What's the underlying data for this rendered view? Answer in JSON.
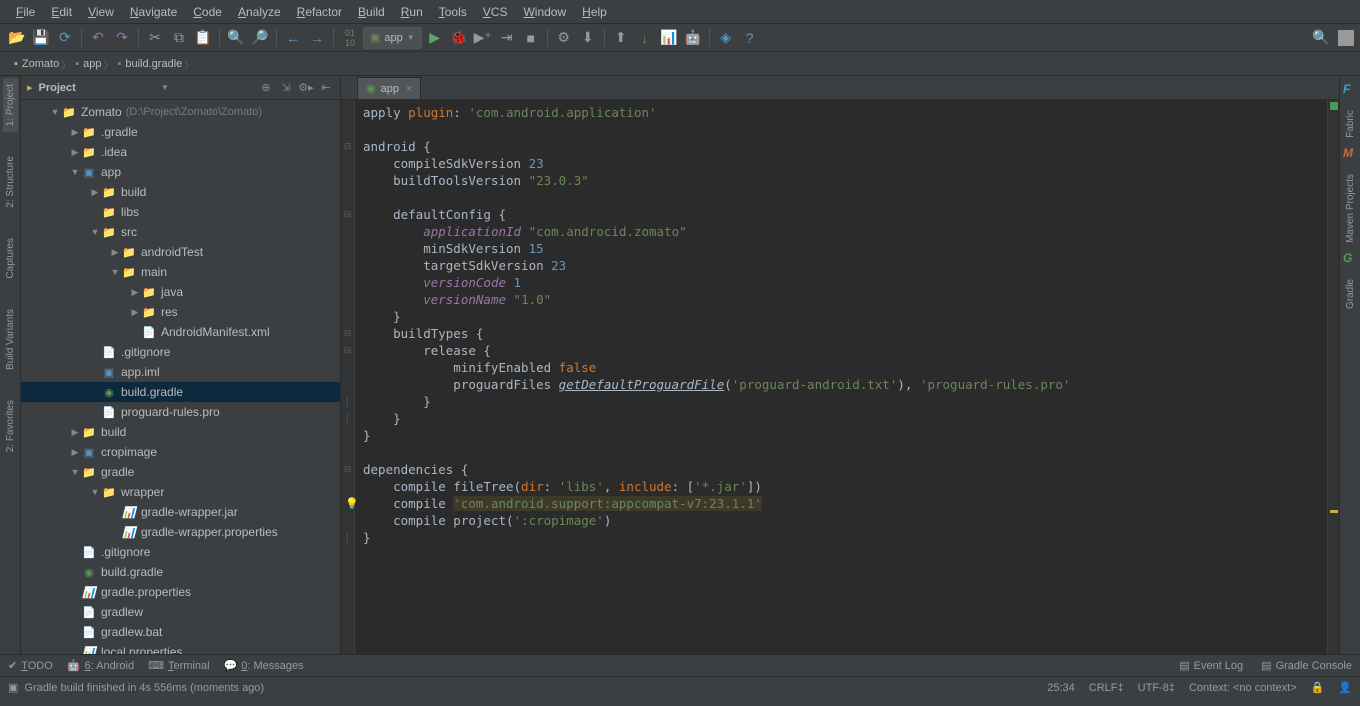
{
  "menu": [
    "File",
    "Edit",
    "View",
    "Navigate",
    "Code",
    "Analyze",
    "Refactor",
    "Build",
    "Run",
    "Tools",
    "VCS",
    "Window",
    "Help"
  ],
  "module_selector": "app",
  "breadcrumbs": [
    {
      "icon": "folder",
      "label": "Zomato"
    },
    {
      "icon": "module",
      "label": "app"
    },
    {
      "icon": "gradle",
      "label": "build.gradle"
    }
  ],
  "left_tabs": [
    "1: Project",
    "2: Structure",
    "Captures",
    "Build Variants",
    "2: Favorites"
  ],
  "right_tabs": [
    "Fabric",
    "Maven Projects",
    "Gradle"
  ],
  "project_tool": {
    "title": "Project"
  },
  "tree": [
    {
      "d": 0,
      "a": "v",
      "i": "folder",
      "n": "Zomato",
      "suffix": "(D:\\Project\\Zomato\\Zomato)"
    },
    {
      "d": 1,
      "a": ">",
      "i": "folder",
      "n": ".gradle"
    },
    {
      "d": 1,
      "a": ">",
      "i": "folder",
      "n": ".idea"
    },
    {
      "d": 1,
      "a": "v",
      "i": "module",
      "n": "app"
    },
    {
      "d": 2,
      "a": ">",
      "i": "folder",
      "n": "build"
    },
    {
      "d": 2,
      "a": "",
      "i": "folder",
      "n": "libs"
    },
    {
      "d": 2,
      "a": "v",
      "i": "folderb",
      "n": "src"
    },
    {
      "d": 3,
      "a": ">",
      "i": "folder",
      "n": "androidTest"
    },
    {
      "d": 3,
      "a": "v",
      "i": "folder",
      "n": "main"
    },
    {
      "d": 4,
      "a": ">",
      "i": "folderb",
      "n": "java"
    },
    {
      "d": 4,
      "a": ">",
      "i": "folder",
      "n": "res"
    },
    {
      "d": 4,
      "a": "",
      "i": "xml",
      "n": "AndroidManifest.xml"
    },
    {
      "d": 2,
      "a": "",
      "i": "file",
      "n": ".gitignore"
    },
    {
      "d": 2,
      "a": "",
      "i": "module",
      "n": "app.iml"
    },
    {
      "d": 2,
      "a": "",
      "i": "gradle",
      "n": "build.gradle",
      "sel": true
    },
    {
      "d": 2,
      "a": "",
      "i": "file",
      "n": "proguard-rules.pro"
    },
    {
      "d": 1,
      "a": ">",
      "i": "folder",
      "n": "build"
    },
    {
      "d": 1,
      "a": ">",
      "i": "module",
      "n": "cropimage"
    },
    {
      "d": 1,
      "a": "v",
      "i": "folder",
      "n": "gradle"
    },
    {
      "d": 2,
      "a": "v",
      "i": "folder",
      "n": "wrapper"
    },
    {
      "d": 3,
      "a": "",
      "i": "prop",
      "n": "gradle-wrapper.jar"
    },
    {
      "d": 3,
      "a": "",
      "i": "prop",
      "n": "gradle-wrapper.properties"
    },
    {
      "d": 1,
      "a": "",
      "i": "file",
      "n": ".gitignore"
    },
    {
      "d": 1,
      "a": "",
      "i": "gradle",
      "n": "build.gradle"
    },
    {
      "d": 1,
      "a": "",
      "i": "prop",
      "n": "gradle.properties"
    },
    {
      "d": 1,
      "a": "",
      "i": "file",
      "n": "gradlew"
    },
    {
      "d": 1,
      "a": "",
      "i": "file",
      "n": "gradlew.bat"
    },
    {
      "d": 1,
      "a": "",
      "i": "prop",
      "n": "local.properties"
    }
  ],
  "editor_tab": {
    "label": "app"
  },
  "code_lines": [
    [
      {
        "t": "apply ",
        "c": "id"
      },
      {
        "t": "plugin",
        "c": "kw"
      },
      {
        "t": ": ",
        "c": "id"
      },
      {
        "t": "'com.android.application'",
        "c": "str"
      }
    ],
    [],
    [
      {
        "t": "android {",
        "c": "id"
      }
    ],
    [
      {
        "t": "    compileSdkVersion ",
        "c": "id"
      },
      {
        "t": "23",
        "c": "num"
      }
    ],
    [
      {
        "t": "    buildToolsVersion ",
        "c": "id"
      },
      {
        "t": "\"23.0.3\"",
        "c": "str"
      }
    ],
    [],
    [
      {
        "t": "    defaultConfig {",
        "c": "id"
      }
    ],
    [
      {
        "t": "        ",
        "c": "id"
      },
      {
        "t": "applicationId",
        "c": "prop"
      },
      {
        "t": " ",
        "c": "id"
      },
      {
        "t": "\"com.androcid.zomato\"",
        "c": "str"
      }
    ],
    [
      {
        "t": "        minSdkVersion ",
        "c": "id"
      },
      {
        "t": "15",
        "c": "num"
      }
    ],
    [
      {
        "t": "        targetSdkVersion ",
        "c": "id"
      },
      {
        "t": "23",
        "c": "num"
      }
    ],
    [
      {
        "t": "        ",
        "c": "id"
      },
      {
        "t": "versionCode",
        "c": "prop"
      },
      {
        "t": " ",
        "c": "id"
      },
      {
        "t": "1",
        "c": "num"
      }
    ],
    [
      {
        "t": "        ",
        "c": "id"
      },
      {
        "t": "versionName",
        "c": "prop"
      },
      {
        "t": " ",
        "c": "id"
      },
      {
        "t": "\"1.0\"",
        "c": "str"
      }
    ],
    [
      {
        "t": "    }",
        "c": "id"
      }
    ],
    [
      {
        "t": "    buildTypes {",
        "c": "id"
      }
    ],
    [
      {
        "t": "        release {",
        "c": "id"
      }
    ],
    [
      {
        "t": "            minifyEnabled ",
        "c": "id"
      },
      {
        "t": "false",
        "c": "kw"
      }
    ],
    [
      {
        "t": "            proguardFiles ",
        "c": "id"
      },
      {
        "t": "getDefaultProguardFile",
        "c": "und"
      },
      {
        "t": "(",
        "c": "id"
      },
      {
        "t": "'proguard-android.txt'",
        "c": "str"
      },
      {
        "t": "), ",
        "c": "id"
      },
      {
        "t": "'proguard-rules.pro'",
        "c": "str"
      }
    ],
    [
      {
        "t": "        }",
        "c": "id"
      }
    ],
    [
      {
        "t": "    }",
        "c": "id"
      }
    ],
    [
      {
        "t": "}",
        "c": "id"
      }
    ],
    [],
    [
      {
        "t": "dependencies {",
        "c": "id"
      }
    ],
    [
      {
        "t": "    compile fileTree(",
        "c": "id"
      },
      {
        "t": "dir",
        "c": "kw"
      },
      {
        "t": ": ",
        "c": "id"
      },
      {
        "t": "'libs'",
        "c": "str"
      },
      {
        "t": ", ",
        "c": "id"
      },
      {
        "t": "include",
        "c": "kw"
      },
      {
        "t": ": [",
        "c": "id"
      },
      {
        "t": "'*.jar'",
        "c": "str"
      },
      {
        "t": "])",
        "c": "id"
      }
    ],
    [
      {
        "t": "    compile ",
        "c": "id",
        "bulb": true
      },
      {
        "t": "'com.android.support:appcompat-v7:23.1.1'",
        "c": "str hl"
      }
    ],
    [
      {
        "t": "    compile project(",
        "c": "id"
      },
      {
        "t": "':cropimage'",
        "c": "str"
      },
      {
        "t": ")",
        "c": "id"
      }
    ],
    [
      {
        "t": "}",
        "c": "id"
      }
    ]
  ],
  "bottom_tools": {
    "left": [
      "TODO",
      "6: Android",
      "Terminal",
      "0: Messages"
    ],
    "right": [
      "Event Log",
      "Gradle Console"
    ]
  },
  "status": {
    "msg": "Gradle build finished in 4s 556ms (moments ago)",
    "pos": "25:34",
    "sep": "CRLF",
    "enc": "UTF-8",
    "ctx": "Context: <no context>"
  }
}
